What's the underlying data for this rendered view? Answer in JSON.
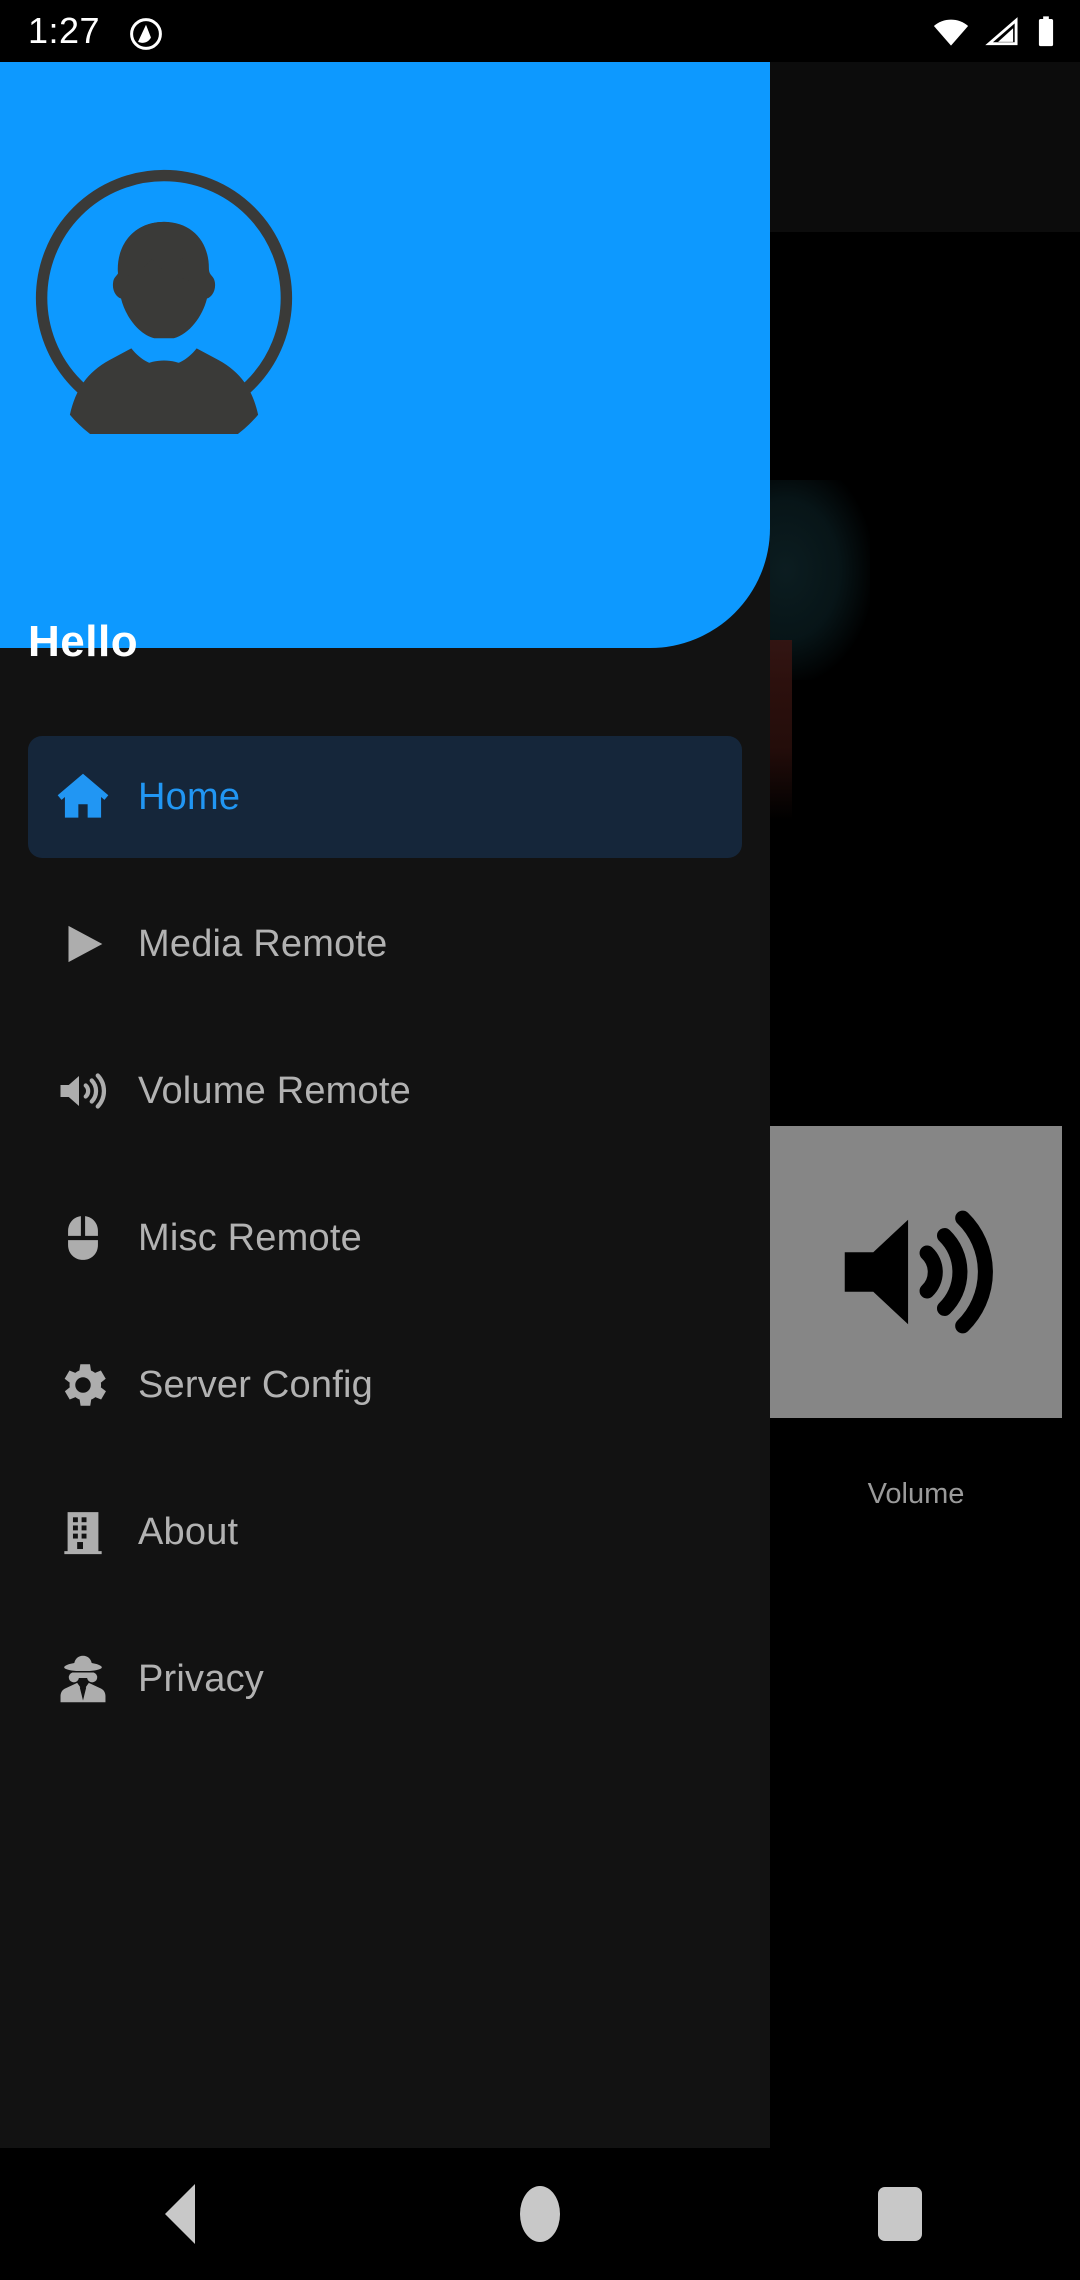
{
  "status_bar": {
    "time": "1:27",
    "notification_icon": "circle-slash-icon",
    "wifi_icon": "wifi-icon",
    "signal_icon": "cellular-signal-icon",
    "battery_icon": "battery-full-icon"
  },
  "drawer": {
    "greeting": "Hello",
    "avatar_icon": "user-avatar-icon",
    "header_color": "#0d99ff",
    "selected_color": "#2196f3",
    "selected_background": "#15263a",
    "items": [
      {
        "label": "Home",
        "icon": "home-icon",
        "selected": true
      },
      {
        "label": "Media Remote",
        "icon": "play-icon",
        "selected": false
      },
      {
        "label": "Volume Remote",
        "icon": "volume-up-icon",
        "selected": false
      },
      {
        "label": "Misc Remote",
        "icon": "mouse-icon",
        "selected": false
      },
      {
        "label": "Server Config",
        "icon": "gear-icon",
        "selected": false
      },
      {
        "label": "About",
        "icon": "building-icon",
        "selected": false
      },
      {
        "label": "Privacy",
        "icon": "spy-icon",
        "selected": false
      }
    ]
  },
  "background": {
    "tiles": [
      {
        "label": "Volume",
        "icon": "volume-speaker-icon",
        "tile_color": "#868686"
      }
    ]
  },
  "nav_bar": {
    "back": "back-triangle",
    "home": "home-circle",
    "recents": "recents-square"
  }
}
